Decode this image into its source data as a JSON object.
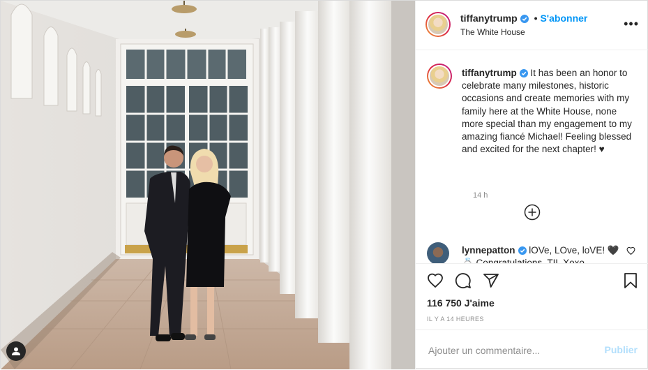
{
  "header": {
    "username": "tiffanytrump",
    "separator": "•",
    "follow_label": "S'abonner",
    "location": "The White House",
    "more_label": "•••"
  },
  "caption": {
    "username": "tiffanytrump",
    "text": "It has been an honor to celebrate many milestones, historic occasions and create memories with my family here at the White House, none more special than my engagement to my amazing fiancé Michael! Feeling blessed and excited for the next chapter! ♥",
    "time": "14 h"
  },
  "comments": [
    {
      "username": "lynnepatton",
      "text": "lOVe, LOve, loVE! 🖤💍 Congratulations, TIL Xoxo"
    }
  ],
  "actions": {
    "likes": "116 750 J'aime",
    "posted_ago": "IL Y A 14 HEURES"
  },
  "add_comment": {
    "placeholder": "Ajouter un commentaire...",
    "publish_label": "Publier"
  },
  "colors": {
    "accent": "#0095f6",
    "publish_disabled": "#b2dffc",
    "text": "#262626",
    "muted": "#8e8e8e"
  }
}
